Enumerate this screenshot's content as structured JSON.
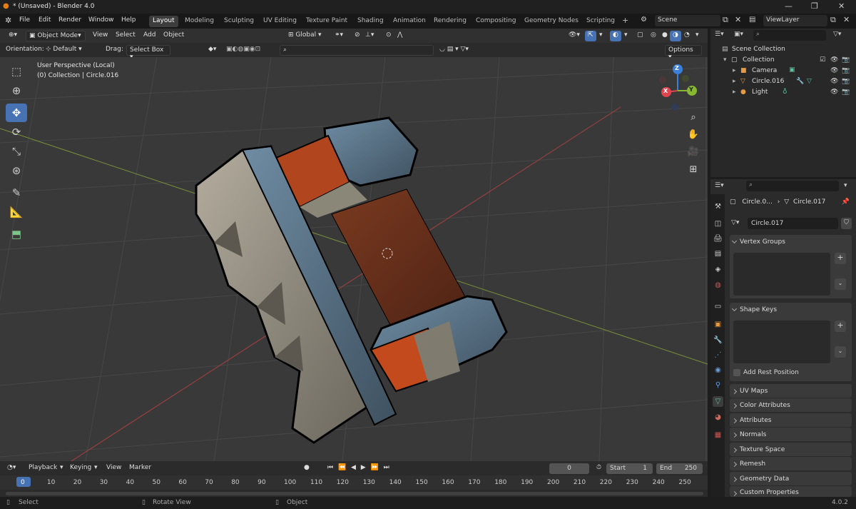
{
  "titlebar": {
    "title": "* (Unsaved) - Blender 4.0",
    "minimize": "—",
    "maximize": "❐",
    "close": "✕"
  },
  "menu": {
    "items": [
      "File",
      "Edit",
      "Render",
      "Window",
      "Help"
    ]
  },
  "workspaces": {
    "tabs": [
      "Layout",
      "Modeling",
      "Sculpting",
      "UV Editing",
      "Texture Paint",
      "Shading",
      "Animation",
      "Rendering",
      "Compositing",
      "Geometry Nodes",
      "Scripting"
    ],
    "active": "Layout",
    "add": "+"
  },
  "scene": {
    "name": "Scene",
    "view_layer": "ViewLayer"
  },
  "viewport_header": {
    "mode": "Object Mode",
    "menus": [
      "View",
      "Select",
      "Add",
      "Object"
    ],
    "transform": "Global"
  },
  "tool_header": {
    "orientation_label": "Orientation:",
    "orientation_value": "Default",
    "drag_label": "Drag:",
    "drag_value": "Select Box",
    "options": "Options"
  },
  "viewport": {
    "view_name": "User Perspective (Local)",
    "collection_info": "(0) Collection | Circle.016",
    "axis_x": "X",
    "axis_y": "Y",
    "axis_z": "Z"
  },
  "toolbar": {
    "icons": [
      "select-box-icon",
      "cursor-icon",
      "move-icon",
      "rotate-icon",
      "scale-icon",
      "transform-icon",
      "annotate-icon",
      "measure-icon",
      "add-cube-icon"
    ],
    "active_index": 2
  },
  "outliner": {
    "root": "Scene Collection",
    "collection": "Collection",
    "items": [
      "Camera",
      "Circle.016",
      "Light"
    ]
  },
  "properties": {
    "breadcrumb_obj": "Circle.0...",
    "breadcrumb_data": "Circle.017",
    "data_name": "Circle.017",
    "panels": {
      "vertex_groups": "Vertex Groups",
      "shape_keys": "Shape Keys",
      "add_rest": "Add Rest Position",
      "uv_maps": "UV Maps",
      "color_attributes": "Color Attributes",
      "attributes": "Attributes",
      "normals": "Normals",
      "texture_space": "Texture Space",
      "remesh": "Remesh",
      "geometry_data": "Geometry Data",
      "custom_properties": "Custom Properties"
    }
  },
  "timeline": {
    "menus": [
      "Playback",
      "Keying",
      "View",
      "Marker"
    ],
    "current_frame": "0",
    "start_label": "Start",
    "start_value": "1",
    "end_label": "End",
    "end_value": "250",
    "frames": [
      "0",
      "10",
      "20",
      "30",
      "40",
      "50",
      "60",
      "70",
      "80",
      "90",
      "100",
      "110",
      "120",
      "130",
      "140",
      "150",
      "160",
      "170",
      "180",
      "190",
      "200",
      "210",
      "220",
      "230",
      "240",
      "250"
    ]
  },
  "statusbar": {
    "select": "Select",
    "rotate_view": "Rotate View",
    "object": "Object",
    "version": "4.0.2"
  },
  "colors": {
    "accent": "#4772b3",
    "viewport_bg": "#393939",
    "panel_bg": "#2b2b2b",
    "x_axis": "#e0444e",
    "y_axis": "#86b832",
    "z_axis": "#3b7fd9"
  }
}
